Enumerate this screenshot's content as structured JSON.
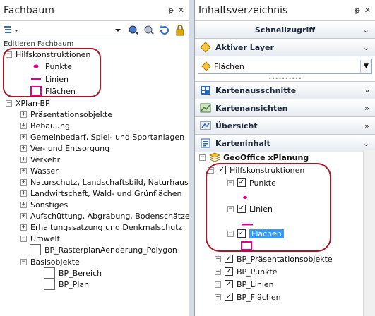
{
  "left_panel": {
    "title": "Fachbaum",
    "pin": "ᵽ",
    "close": "✕",
    "tree_header": "Editieren Fachbaum",
    "hilfs": {
      "label": "Hilfskonstruktionen",
      "children": [
        "Punkte",
        "Linien",
        "Flächen"
      ]
    },
    "xplan": {
      "label": "XPlan-BP",
      "groups": [
        "Präsentationsobjekte",
        "Bebauung",
        "Gemeinbedarf, Spiel- und Sportanlagen",
        "Ver- und Entsorgung",
        "Verkehr",
        "Wasser",
        "Naturschutz, Landschaftsbild, Naturhaushal",
        "Landwirtschaft, Wald- und Grünflächen",
        "Sonstiges",
        "Aufschüttung, Abgrabung, Bodenschätze",
        "Erhaltungssatzung und Denkmalschutz",
        "Umwelt"
      ],
      "umwelt_child": "BP_RasterplanAenderung_Polygon",
      "basis": {
        "label": "Basisobjekte",
        "children": [
          "BP_Bereich",
          "BP_Plan"
        ]
      }
    }
  },
  "right_panel": {
    "title": "Inhaltsverzeichnis",
    "pin": "ᵽ",
    "close": "✕",
    "sections": {
      "schnellzugriff": "Schnellzugriff",
      "aktiver_layer": "Aktiver Layer",
      "kartenausschnitte": "Kartenausschnitte",
      "kartenansichten": "Kartenansichten",
      "uebersicht": "Übersicht",
      "karteninhalt": "Karteninhalt"
    },
    "chevron": "»",
    "active_layer_value": "Flächen",
    "toc": {
      "root": "GeoOffice xPlanung",
      "hilfs": "Hilfskonstruktionen",
      "punkte": "Punkte",
      "linien": "Linien",
      "flaechen": "Flächen",
      "others": [
        "BP_Präsentationsobjekte",
        "BP_Punkte",
        "BP_Linien",
        "BP_Flächen"
      ]
    }
  },
  "colors": {
    "highlight_oval": "#a6172a",
    "symbol_magenta": "#e0008c",
    "selection": "#3399ff"
  }
}
